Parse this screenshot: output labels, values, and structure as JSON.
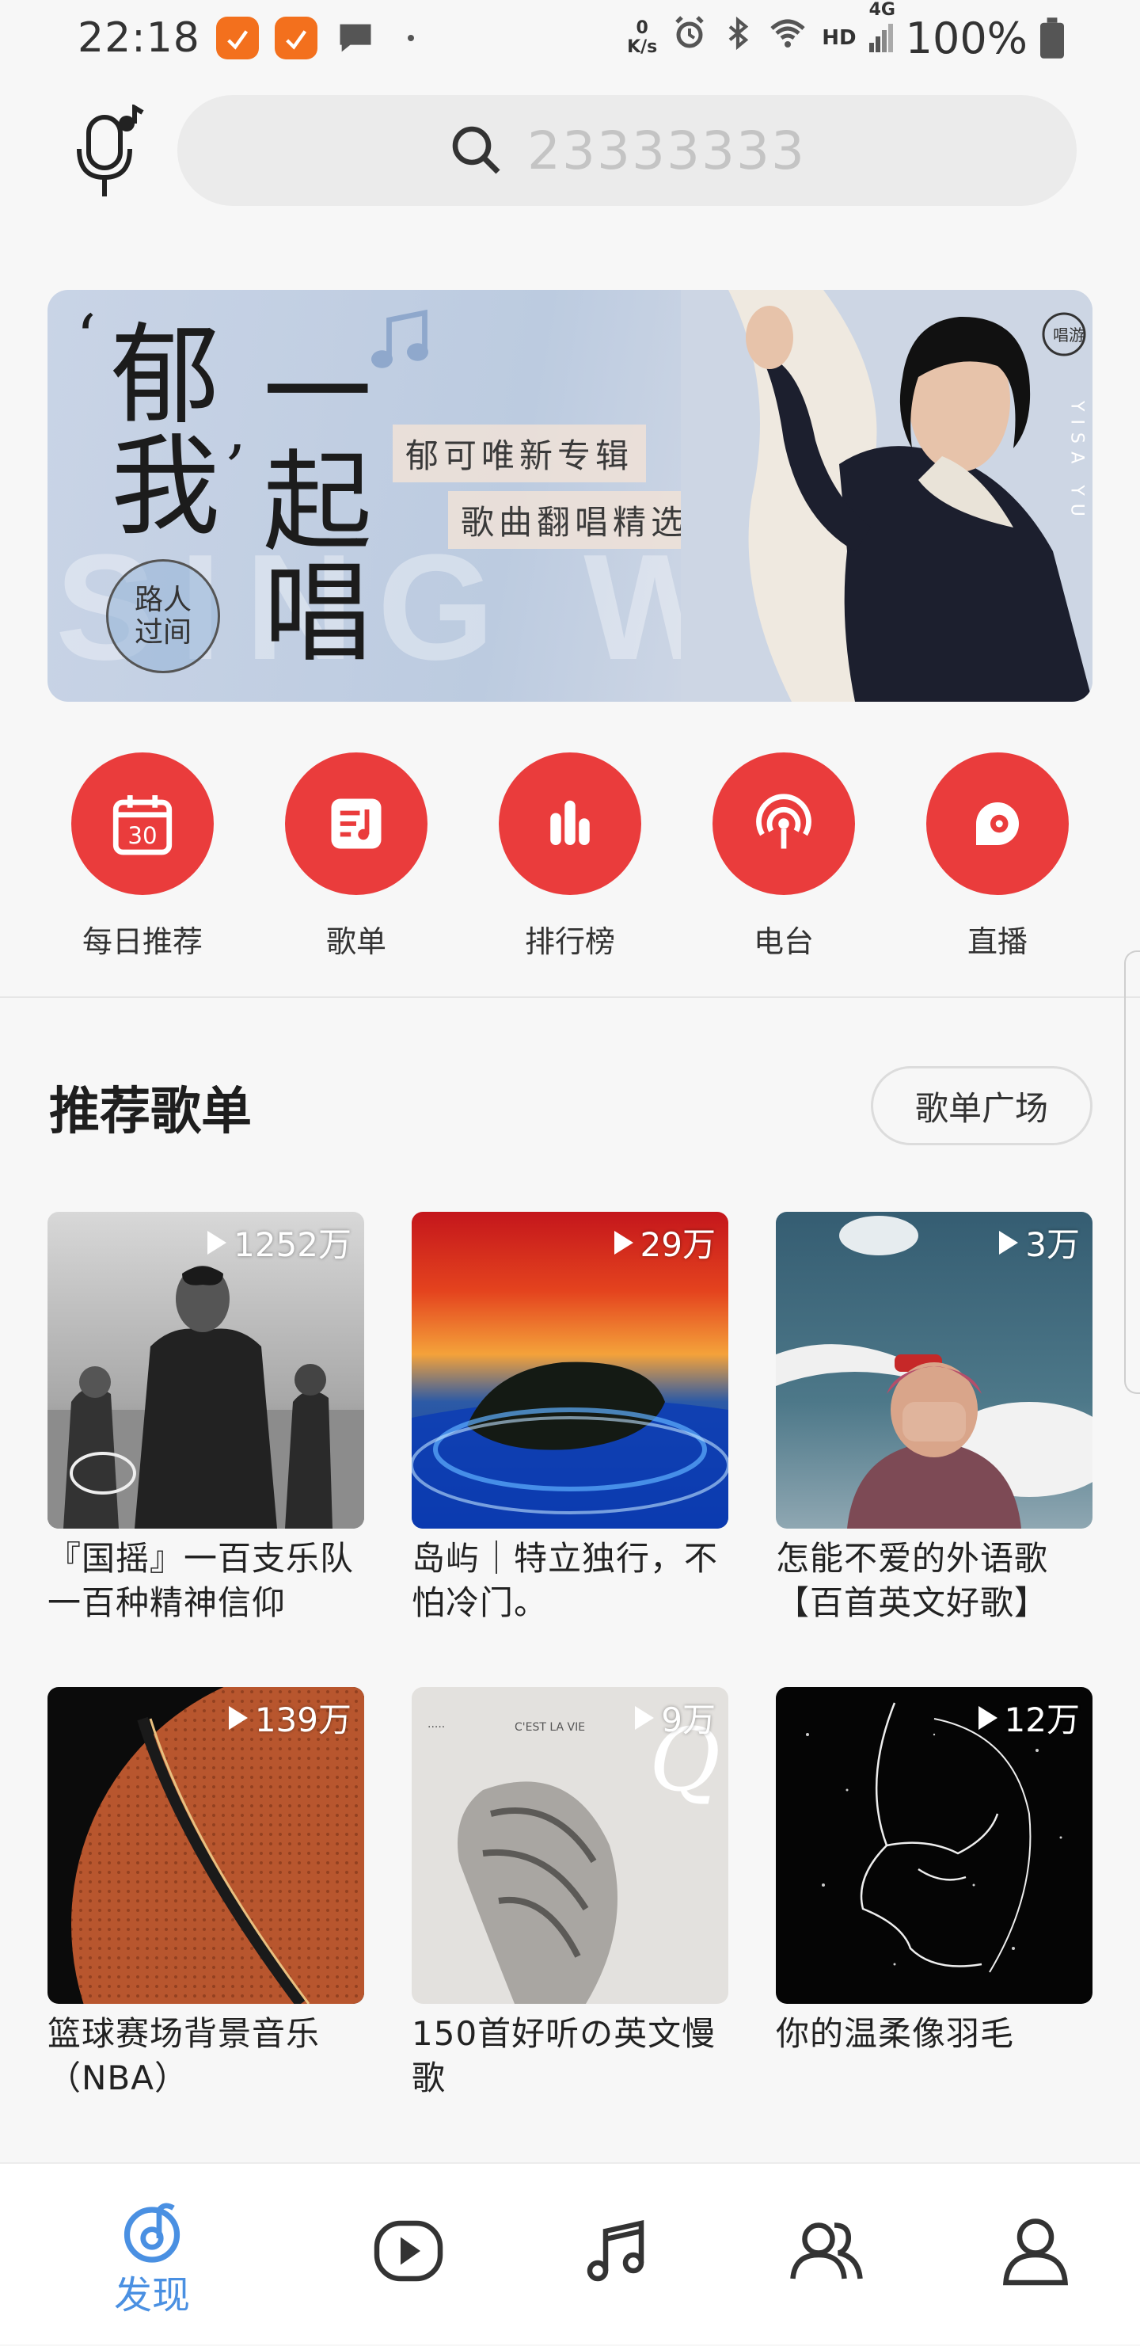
{
  "status_bar": {
    "time": "22:18",
    "network_speed_top": "0",
    "network_speed_bottom": "K/s",
    "network_type": "HD",
    "signal": "4G",
    "battery": "100%"
  },
  "search": {
    "placeholder": "23333333"
  },
  "banner": {
    "char1": "郁",
    "char2": "我",
    "char3": "一",
    "char4": "起",
    "char5": "唱",
    "tag1": "郁可唯新专辑",
    "tag2": "歌曲翻唱精选",
    "circle_line1": "路人",
    "circle_line2": "过间",
    "bg_text": "SING WITH",
    "logo_text": "唱游",
    "side_text": "YISA YU"
  },
  "quick_nav": [
    {
      "label": "每日推荐",
      "icon": "calendar-icon",
      "day": "30"
    },
    {
      "label": "歌单",
      "icon": "playlist-icon"
    },
    {
      "label": "排行榜",
      "icon": "chart-icon"
    },
    {
      "label": "电台",
      "icon": "radio-icon"
    },
    {
      "label": "直播",
      "icon": "live-icon"
    }
  ],
  "section": {
    "title": "推荐歌单",
    "plaza_button": "歌单广场"
  },
  "playlists": [
    {
      "count": "1252万",
      "title": "『国摇』一百支乐队一百种精神信仰"
    },
    {
      "count": "29万",
      "title": "岛屿｜特立独行，不怕冷门。"
    },
    {
      "count": "3万",
      "title": "怎能不爱的外语歌【百首英文好歌】"
    },
    {
      "count": "139万",
      "title": "篮球赛场背景音乐（NBA）"
    },
    {
      "count": "9万",
      "title": "150首好听の英文慢歌"
    },
    {
      "count": "12万",
      "title": "你的温柔像羽毛"
    }
  ],
  "tabs": [
    {
      "label": "发现",
      "icon": "discover-icon",
      "active": true
    },
    {
      "label": "",
      "icon": "video-icon"
    },
    {
      "label": "",
      "icon": "music-icon"
    },
    {
      "label": "",
      "icon": "friends-icon"
    },
    {
      "label": "",
      "icon": "profile-icon"
    }
  ],
  "colors": {
    "accent_red": "#ea3c3c",
    "active_tab_blue": "#4a90e2",
    "notification_orange": "#f3701d"
  }
}
